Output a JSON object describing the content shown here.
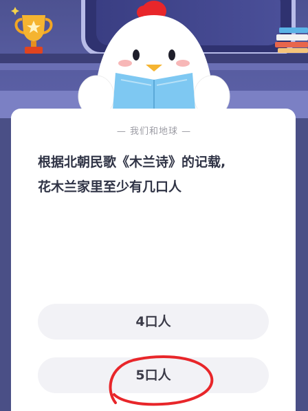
{
  "header": {
    "decor": [
      "trophy-icon",
      "chicken-mascot-reading-book",
      "books-icon"
    ]
  },
  "card": {
    "subtitle": "— 我们和地球 —",
    "question_line1": "根据北朝民歌《木兰诗》的记载,",
    "question_line2": "花木兰家里至少有几口人"
  },
  "options": [
    {
      "label": "4口人"
    },
    {
      "label": "5口人",
      "annotated": "red-hand-drawn-circle"
    }
  ],
  "colors": {
    "header_bg": "#4d5291",
    "card_bg": "#ffffff",
    "option_bg": "#f2f2f6",
    "annotation_red": "#e8262a",
    "trophy_gold": "#f2a623"
  }
}
